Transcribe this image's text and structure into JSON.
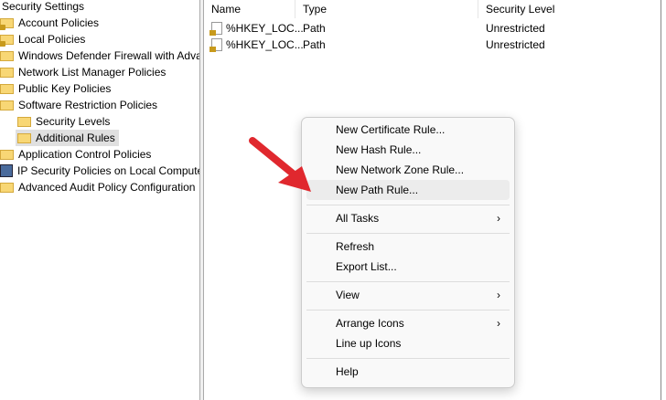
{
  "tree": {
    "root": "Security Settings",
    "items": [
      {
        "label": "Account Policies",
        "icon": "folder-lock"
      },
      {
        "label": "Local Policies",
        "icon": "folder-lock"
      },
      {
        "label": "Windows Defender Firewall with Advanced Security",
        "icon": "folder"
      },
      {
        "label": "Network List Manager Policies",
        "icon": "folder"
      },
      {
        "label": "Public Key Policies",
        "icon": "folder"
      },
      {
        "label": "Software Restriction Policies",
        "icon": "folder"
      },
      {
        "label": "Security Levels",
        "icon": "folder"
      },
      {
        "label": "Additional Rules",
        "icon": "folder"
      },
      {
        "label": "Application Control Policies",
        "icon": "folder"
      },
      {
        "label": "IP Security Policies on Local Computer",
        "icon": "computer"
      },
      {
        "label": "Advanced Audit Policy Configuration",
        "icon": "folder"
      }
    ]
  },
  "list": {
    "columns": [
      "Name",
      "Type",
      "Security Level"
    ],
    "rows": [
      {
        "name": "%HKEY_LOC...",
        "type": "Path",
        "level": "Unrestricted"
      },
      {
        "name": "%HKEY_LOC...",
        "type": "Path",
        "level": "Unrestricted"
      }
    ]
  },
  "menu": {
    "items": [
      "New Certificate Rule...",
      "New Hash Rule...",
      "New Network Zone Rule...",
      "New Path Rule...",
      "All Tasks",
      "Refresh",
      "Export List...",
      "View",
      "Arrange Icons",
      "Line up Icons",
      "Help"
    ],
    "submenu_glyph": "›"
  },
  "colors": {
    "arrow": "#e0282e"
  }
}
